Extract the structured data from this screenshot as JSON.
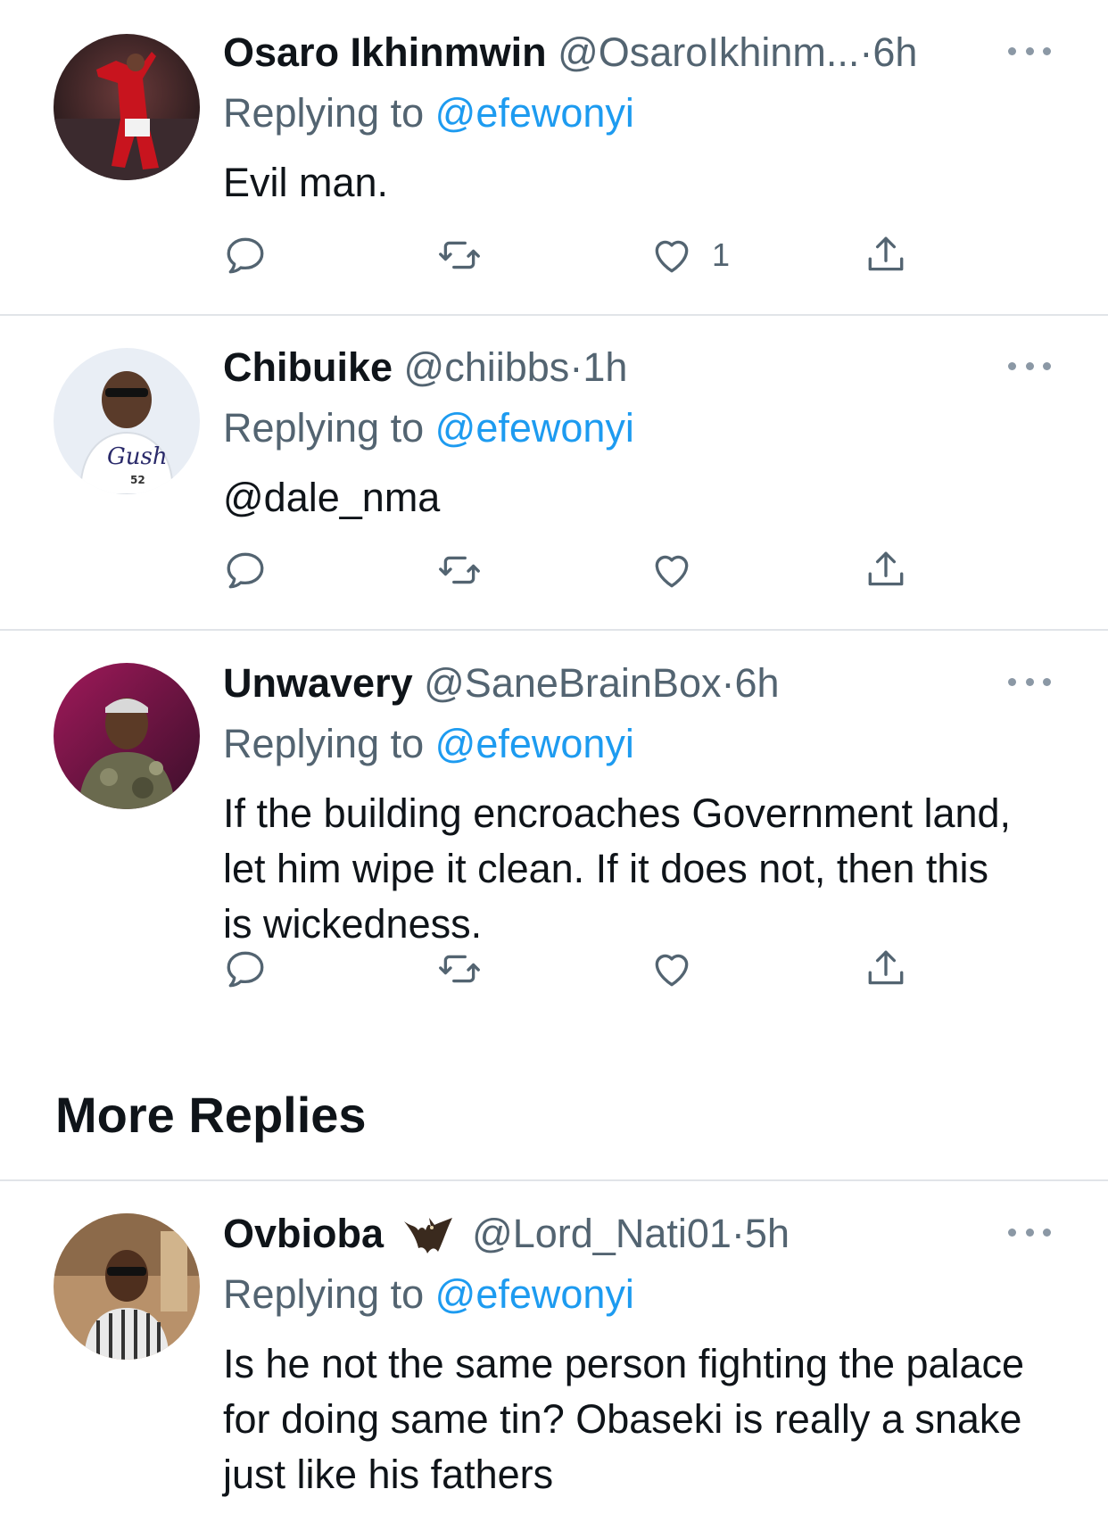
{
  "tweets": [
    {
      "name": "Osaro Ikhinmwin",
      "handle": "@OsaroIkhinm...",
      "dot": "·",
      "time": "6h",
      "replying_prefix": "Replying to ",
      "replying_to": "@efewonyi",
      "text": "Evil man.",
      "like_count": "1"
    },
    {
      "name": "Chibuike",
      "handle": "@chiibbs",
      "dot": "·",
      "time": "1h",
      "replying_prefix": "Replying to ",
      "replying_to": "@efewonyi",
      "text": "@dale_nma",
      "like_count": ""
    },
    {
      "name": "Unwavery",
      "handle": "@SaneBrainBox",
      "dot": "·",
      "time": "6h",
      "replying_prefix": "Replying to ",
      "replying_to": "@efewonyi",
      "text": "If the building encroaches Government land, let him wipe it clean. If it does not, then this is wickedness.",
      "like_count": ""
    },
    {
      "name": "Ovbioba",
      "handle": "@Lord_Nati01",
      "dot": "·",
      "time": "5h",
      "replying_prefix": "Replying to ",
      "replying_to": "@efewonyi",
      "text": "Is he not the same person fighting the palace for doing same tin? Obaseki is really a snake just like his fathers",
      "like_count": ""
    }
  ],
  "more_replies_title": "More Replies",
  "colors": {
    "accent": "#1d9bf0",
    "secondary_text": "#536471",
    "divider": "#e1e4e8"
  },
  "icons": [
    "reply-icon",
    "retweet-icon",
    "like-icon",
    "share-icon",
    "more-options-icon",
    "bat-emoji-icon"
  ]
}
